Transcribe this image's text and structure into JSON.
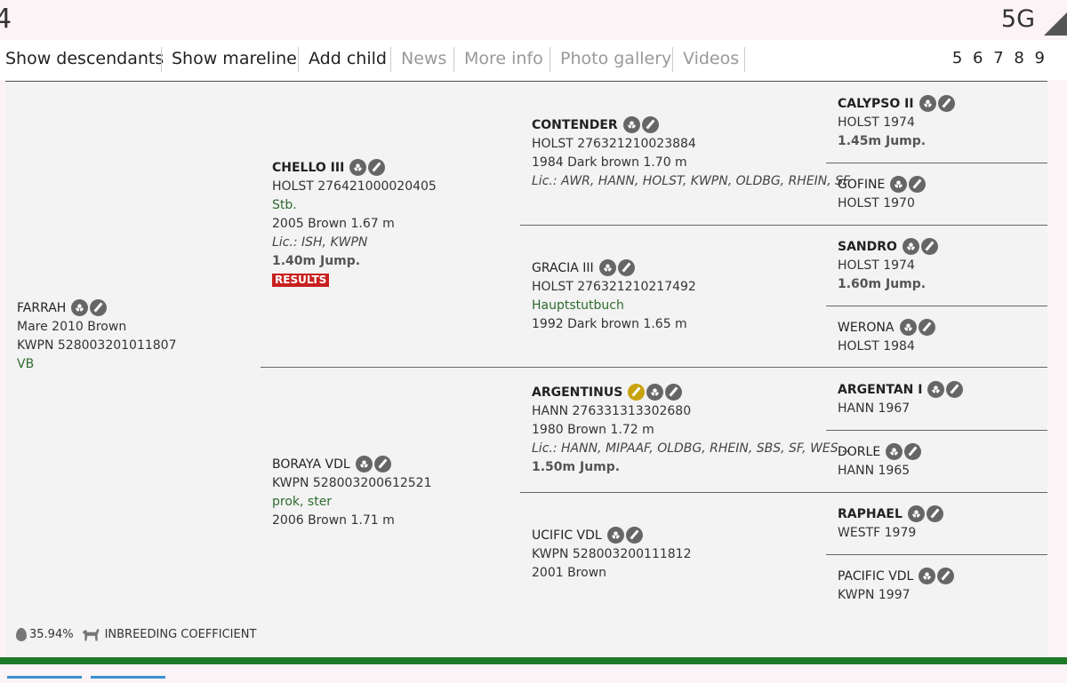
{
  "status": {
    "left": "4",
    "network": "5G"
  },
  "menu": {
    "items": [
      {
        "label": "Show descendants",
        "active": true
      },
      {
        "label": "Show mareline",
        "active": true
      },
      {
        "label": "Add child",
        "active": true
      },
      {
        "label": "News",
        "active": false
      },
      {
        "label": "More info",
        "active": false
      },
      {
        "label": "Photo gallery",
        "active": false
      },
      {
        "label": "Videos",
        "active": false
      }
    ],
    "pager": "5 6 7 8 9"
  },
  "subject": {
    "name": "FARRAH",
    "line1": "Mare 2010 Brown",
    "line2": "KWPN 528003201011807",
    "line3": "VB"
  },
  "sire": {
    "name": "CHELLO III",
    "reg": "HOLST 276421000020405",
    "book": "Stb.",
    "desc": "2005 Brown 1.67 m",
    "lic": "Lic.: ISH, KWPN",
    "jump": "1.40m Jump.",
    "results": "RESULTS"
  },
  "dam": {
    "name": "BORAYA VDL",
    "reg": "KWPN 528003200612521",
    "book": "prok, ster",
    "desc": "2006 Brown 1.71 m"
  },
  "ss": {
    "name": "CONTENDER",
    "reg": "HOLST 276321210023884",
    "desc": "1984 Dark brown 1.70 m",
    "lic": "Lic.: AWR, HANN, HOLST, KWPN, OLDBG, RHEIN, SF"
  },
  "sd": {
    "name": "GRACIA III",
    "reg": "HOLST 276321210217492",
    "book": "Hauptstutbuch",
    "desc": "1992 Dark brown 1.65 m"
  },
  "ds": {
    "name": "ARGENTINUS",
    "reg": "HANN 276331313302680",
    "desc": "1980 Brown 1.72 m",
    "lic": "Lic.: HANN, MIPAAF, OLDBG, RHEIN, SBS, SF, WES...",
    "jump": "1.50m Jump."
  },
  "dd": {
    "name": "UCIFIC VDL",
    "reg": "KWPN 528003200111812",
    "desc": "2001 Brown"
  },
  "g3": [
    {
      "name": "CALYPSO II",
      "reg": "HOLST 1974",
      "jump": "1.45m Jump."
    },
    {
      "name": "GOFINE",
      "reg": "HOLST 1970"
    },
    {
      "name": "SANDRO",
      "reg": "HOLST 1974",
      "jump": "1.60m Jump."
    },
    {
      "name": "WERONA",
      "reg": "HOLST 1984"
    },
    {
      "name": "ARGENTAN I",
      "reg": "HANN 1967"
    },
    {
      "name": "DORLE",
      "reg": "HANN 1965"
    },
    {
      "name": "RAPHAEL",
      "reg": "WESTF 1979"
    },
    {
      "name": "PACIFIC VDL",
      "reg": "KWPN 1997"
    }
  ],
  "footer": {
    "percent": "35.94%",
    "label": "INBREEDING COEFFICIENT"
  }
}
